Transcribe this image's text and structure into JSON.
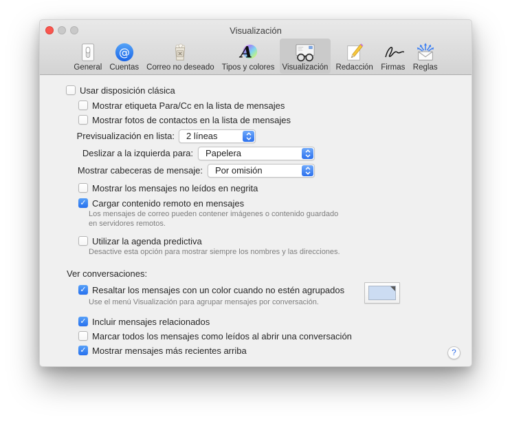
{
  "window": {
    "title": "Visualización"
  },
  "toolbar": {
    "items": [
      {
        "label": "General",
        "icon": "switch-icon",
        "selected": false
      },
      {
        "label": "Cuentas",
        "icon": "at-icon",
        "selected": false
      },
      {
        "label": "Correo no deseado",
        "icon": "trash-icon",
        "selected": false
      },
      {
        "label": "Tipos y colores",
        "icon": "fonts-colors-icon",
        "selected": false
      },
      {
        "label": "Visualización",
        "icon": "glasses-envelope-icon",
        "selected": true
      },
      {
        "label": "Redacción",
        "icon": "pencil-icon",
        "selected": false
      },
      {
        "label": "Firmas",
        "icon": "signature-icon",
        "selected": false
      },
      {
        "label": "Reglas",
        "icon": "envelope-arrows-icon",
        "selected": false
      }
    ]
  },
  "main": {
    "classic_layout": {
      "label": "Usar disposición clásica",
      "checked": false
    },
    "to_cc_label": {
      "label": "Mostrar etiqueta Para/Cc en la lista de mensajes",
      "checked": false
    },
    "contact_photos": {
      "label": "Mostrar fotos de contactos en la lista de mensajes",
      "checked": false
    },
    "list_preview": {
      "label": "Previsualización en lista:",
      "value": "2 líneas"
    },
    "swipe_left": {
      "label": "Deslizar a la izquierda para:",
      "value": "Papelera"
    },
    "headers": {
      "label": "Mostrar cabeceras de mensaje:",
      "value": "Por omisión"
    },
    "unread_bold": {
      "label": "Mostrar los mensajes no leídos en negrita",
      "checked": false
    },
    "remote_content": {
      "label": "Cargar contenido remoto en mensajes",
      "checked": true,
      "note_line1": "Los mensajes de correo pueden contener imágenes o contenido guardado",
      "note_line2": "en servidores remotos."
    },
    "predictive": {
      "label": "Utilizar la agenda predictiva",
      "checked": false,
      "note": "Desactive esta opción para mostrar siempre los nombres y las direcciones."
    },
    "conversations_heading": "Ver conversaciones:",
    "highlight": {
      "label": "Resaltar los mensajes con un color cuando no estén agrupados",
      "checked": true,
      "note": "Use el menú Visualización para agrupar mensajes por conversación.",
      "swatch_color": "#ccdcf2"
    },
    "include_related": {
      "label": "Incluir mensajes relacionados",
      "checked": true
    },
    "mark_read": {
      "label": "Marcar todos los mensajes como leídos al abrir una conversación",
      "checked": false
    },
    "recent_top": {
      "label": "Mostrar mensajes más recientes arriba",
      "checked": true
    },
    "help_label": "?"
  }
}
